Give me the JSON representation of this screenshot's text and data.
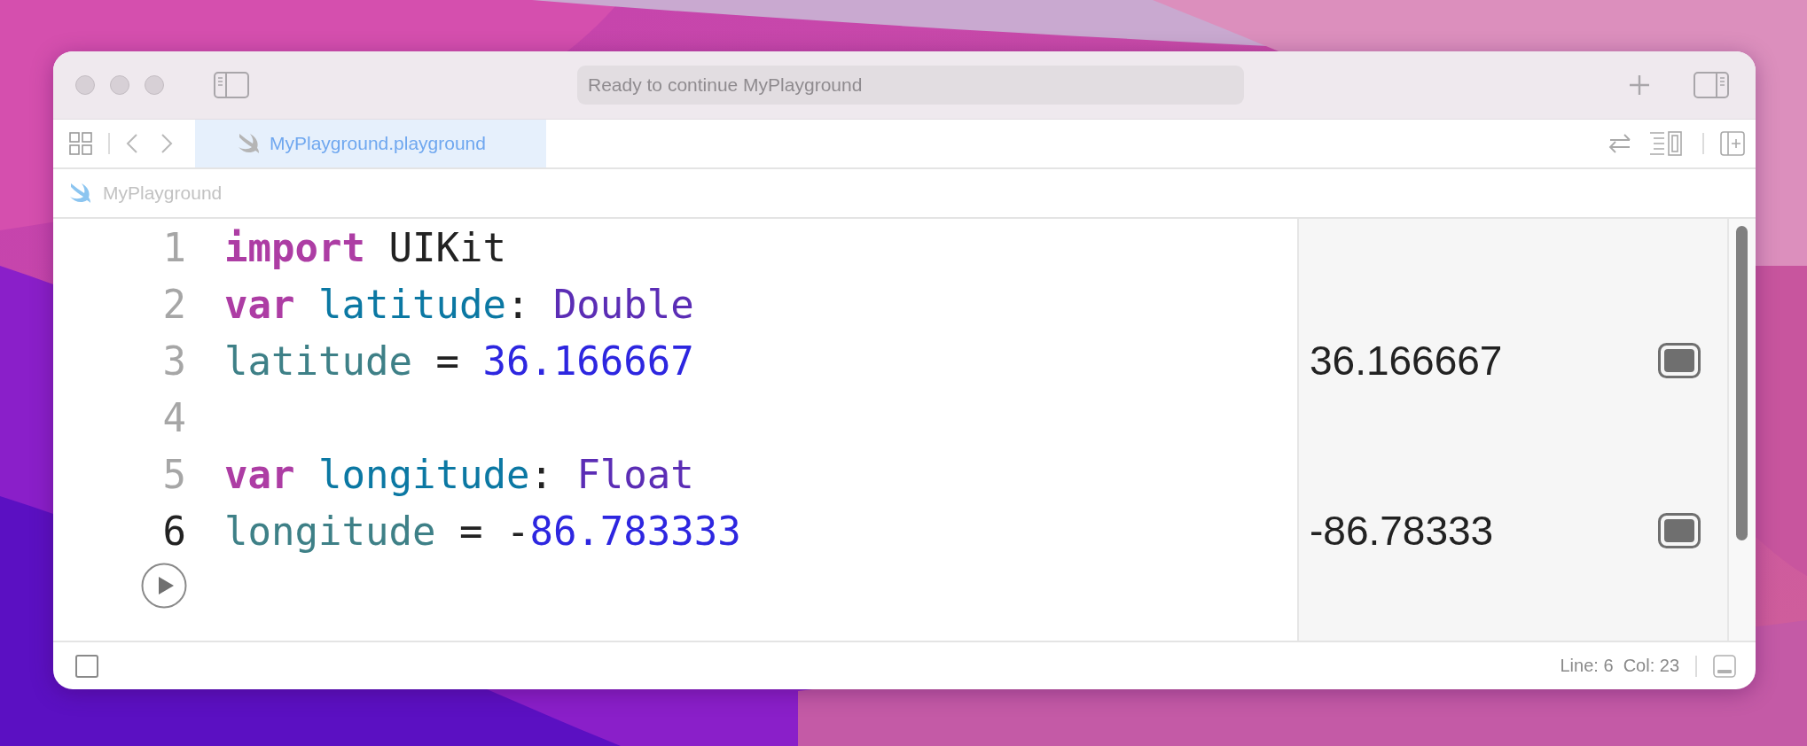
{
  "window": {
    "activity_status": "Ready to continue MyPlayground"
  },
  "tabs": [
    {
      "label": "MyPlayground.playground",
      "selected": true
    }
  ],
  "breadcrumb": {
    "label": "MyPlayground"
  },
  "editor": {
    "lines": [
      {
        "number": "1",
        "current": false,
        "tokens": [
          {
            "text": "import",
            "kind": "keyword"
          },
          {
            "text": " UIKit",
            "kind": "plain"
          }
        ]
      },
      {
        "number": "2",
        "current": false,
        "tokens": [
          {
            "text": "var ",
            "kind": "keyword"
          },
          {
            "text": "latitude",
            "kind": "declaration"
          },
          {
            "text": ": ",
            "kind": "plain"
          },
          {
            "text": "Double",
            "kind": "type"
          }
        ]
      },
      {
        "number": "3",
        "current": false,
        "result": "36.166667",
        "tokens": [
          {
            "text": "latitude",
            "kind": "identifier"
          },
          {
            "text": " = ",
            "kind": "plain"
          },
          {
            "text": "36.166667",
            "kind": "number"
          }
        ]
      },
      {
        "number": "4",
        "current": false
      },
      {
        "number": "5",
        "current": false,
        "tokens": [
          {
            "text": "var ",
            "kind": "keyword"
          },
          {
            "text": "longitude",
            "kind": "declaration"
          },
          {
            "text": ": ",
            "kind": "plain"
          },
          {
            "text": "Float",
            "kind": "type"
          }
        ]
      },
      {
        "number": "6",
        "current": true,
        "result": "-86.78333",
        "tokens": [
          {
            "text": "longitude",
            "kind": "identifier"
          },
          {
            "text": " = -",
            "kind": "plain"
          },
          {
            "text": "86.783333",
            "kind": "number"
          }
        ]
      }
    ]
  },
  "status_bar": {
    "position": "Line: 6  Col: 23"
  }
}
